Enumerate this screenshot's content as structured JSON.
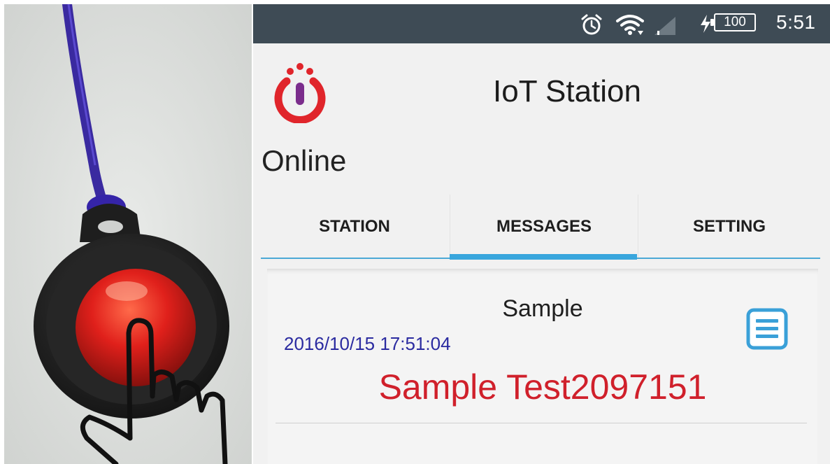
{
  "status_bar": {
    "icons": [
      "alarm-clock-icon",
      "wifi-icon",
      "signal-icon",
      "charging-icon"
    ],
    "battery": "100",
    "time": "5:51"
  },
  "app": {
    "title": "IoT Station",
    "logo": "power-logo-icon",
    "status": "Online"
  },
  "tabs": [
    {
      "label": "STATION",
      "selected": false
    },
    {
      "label": "MESSAGES",
      "selected": true
    },
    {
      "label": "SETTING",
      "selected": false
    }
  ],
  "messages": [
    {
      "title": "Sample",
      "timestamp": "2016/10/15 17:51:04",
      "body": "Sample Test2097151",
      "action_icon": "message-menu-icon"
    }
  ],
  "colors": {
    "status_bar": "#3e4b55",
    "accent": "#39a6dd",
    "timestamp": "#2b2ba0",
    "message_body": "#d0202b",
    "logo_red": "#e0252b",
    "logo_purple": "#7b2d8c"
  }
}
